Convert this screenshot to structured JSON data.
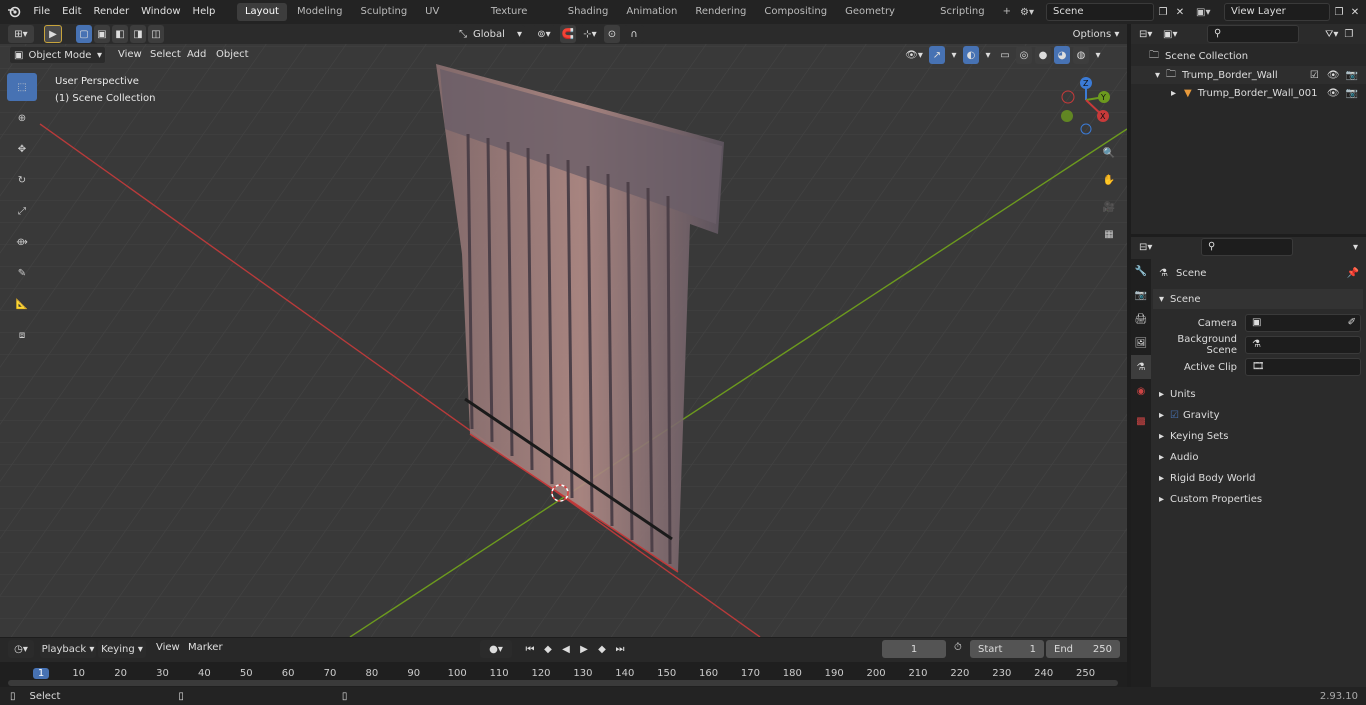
{
  "menu": [
    "File",
    "Edit",
    "Render",
    "Window",
    "Help"
  ],
  "workspaces": [
    "Layout",
    "Modeling",
    "Sculpting",
    "UV Editing",
    "Texture Paint",
    "Shading",
    "Animation",
    "Rendering",
    "Compositing",
    "Geometry Nodes",
    "Scripting"
  ],
  "add_tab": "+",
  "scene_name": "Scene",
  "view_layer": "View Layer",
  "transform_orientation": "Global",
  "options_label": "Options",
  "mode": "Object Mode",
  "view_menu": [
    "View",
    "Select",
    "Add",
    "Object"
  ],
  "viewport_info": {
    "line1": "User Perspective",
    "line2": "(1) Scene Collection"
  },
  "outliner": {
    "root": "Scene Collection",
    "items": [
      {
        "name": "Trump_Border_Wall"
      },
      {
        "name": "Trump_Border_Wall_001"
      }
    ]
  },
  "properties": {
    "context": "Scene",
    "section": "Scene",
    "camera_label": "Camera",
    "background_label": "Background Scene",
    "clip_label": "Active Clip",
    "panels": [
      "Units",
      "Gravity",
      "Keying Sets",
      "Audio",
      "Rigid Body World",
      "Custom Properties"
    ]
  },
  "timeline": {
    "menus": [
      "Playback",
      "Keying",
      "View",
      "Marker"
    ],
    "current_frame": "1",
    "start_label": "Start",
    "start": "1",
    "end_label": "End",
    "end": "250",
    "ticks": [
      "1",
      "10",
      "20",
      "30",
      "40",
      "50",
      "60",
      "70",
      "80",
      "90",
      "100",
      "110",
      "120",
      "130",
      "140",
      "150",
      "160",
      "170",
      "180",
      "190",
      "200",
      "210",
      "220",
      "230",
      "240",
      "250"
    ]
  },
  "status": {
    "left": "Select",
    "version": "2.93.10"
  },
  "colors": {
    "accent": "#4772b3",
    "x_axis": "#c83a3a",
    "y_axis": "#6c9a1e",
    "grid": "#444444"
  }
}
